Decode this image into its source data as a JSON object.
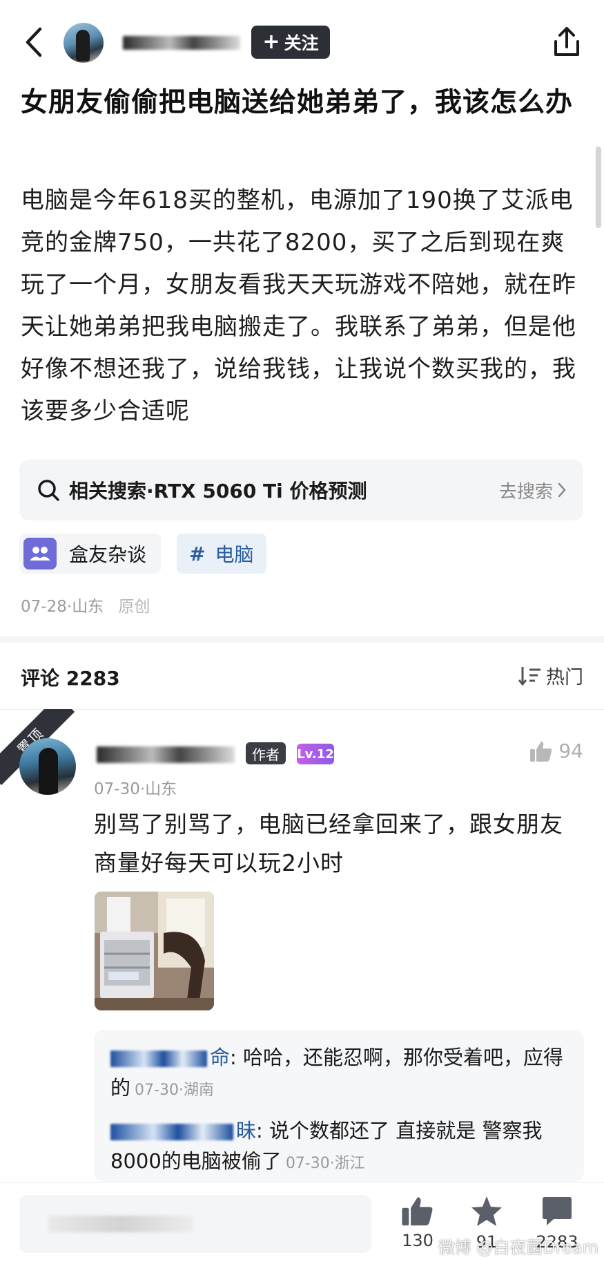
{
  "header": {
    "follow_label": "关注",
    "follow_plus": "+"
  },
  "post": {
    "title": "女朋友偷偷把电脑送给她弟弟了，我该怎么办",
    "body": "电脑是今年618买的整机，电源加了190换了艾派电竞的金牌750，一共花了8200，买了之后到现在爽玩了一个月，女朋友看我天天玩游戏不陪她，就在昨天让她弟弟把我电脑搬走了。我联系了弟弟，但是他好像不想还我了，说给我钱，让我说个数买我的，我该要多少合适呢",
    "related_search": "相关搜索·RTX 5060 Ti 价格预测",
    "related_search_action": "去搜索",
    "tags": [
      {
        "label": "盒友杂谈"
      },
      {
        "hash": "#",
        "label": "电脑"
      }
    ],
    "date_location": "07-28·山东",
    "original": "原创"
  },
  "comments": {
    "title": "评论 2283",
    "sort_label": "热门",
    "pinned_label": "置顶",
    "items": [
      {
        "author_badge": "作者",
        "level": "Lv.12",
        "likes": "94",
        "meta": "07-30·山东",
        "text": "别骂了别骂了，电脑已经拿回来了，跟女朋友商量好每天可以玩2小时",
        "replies": [
          {
            "name_tail": "命",
            "text": "哈哈，还能忍啊，那你受着吧，应得的",
            "meta": "07-30·湖南"
          },
          {
            "name_tail": "昧",
            "text": "说个数都还了 直接就是 警察我8000的电脑被偷了",
            "meta": "07-30·浙江"
          }
        ]
      }
    ]
  },
  "bottom_bar": {
    "likes": "130",
    "favorites": "91",
    "comments": "2283",
    "watermark": "微博 @白夜菌Dream"
  },
  "colors": {
    "follow_bg": "#2c2f36",
    "level_badge": "#b05be6",
    "topic_tag_text": "#2b5d9e",
    "group_icon": "#6f6cd8"
  }
}
